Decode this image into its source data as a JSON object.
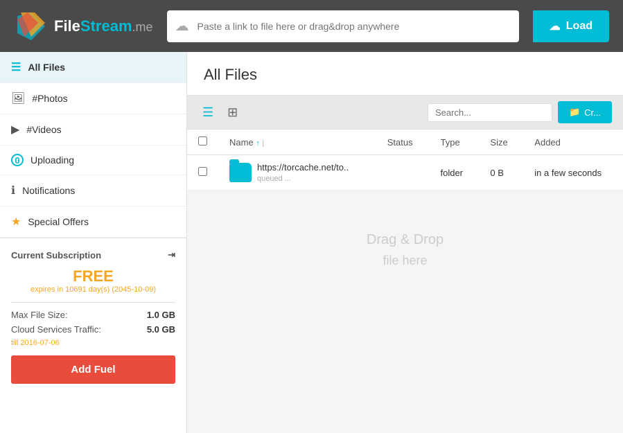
{
  "header": {
    "logo_file": "File",
    "logo_stream": "Stream",
    "logo_me": ".me",
    "url_placeholder": "Paste a link to file here or drag&drop anywhere",
    "load_label": "Load",
    "load_icon": "☁"
  },
  "sidebar": {
    "items": [
      {
        "id": "all-files",
        "icon": "☰",
        "label": "All Files",
        "active": true
      },
      {
        "id": "photos",
        "icon": "🖼",
        "label": "#Photos",
        "active": false
      },
      {
        "id": "videos",
        "icon": "▶",
        "label": "#Videos",
        "active": false
      },
      {
        "id": "uploading",
        "icon": "⓪",
        "label": "Uploading",
        "active": false
      },
      {
        "id": "notifications",
        "icon": "ℹ",
        "label": "Notifications",
        "active": false
      },
      {
        "id": "special-offers",
        "icon": "★",
        "label": "Special Offers",
        "active": false
      }
    ],
    "subscription": {
      "title": "Current Subscription",
      "plan": "FREE",
      "expires": "expires in 10691 day(s) (2045-10-09)",
      "max_file_size_label": "Max File Size:",
      "max_file_size_value": "1.0 GB",
      "traffic_label": "Cloud Services Traffic:",
      "traffic_value": "5.0 GB",
      "traffic_note": "till 2016-07-06",
      "add_fuel_label": "Add Fuel"
    }
  },
  "content": {
    "page_title": "All Files",
    "toolbar": {
      "list_view_icon": "☰",
      "grid_view_icon": "⊞",
      "search_placeholder": "Search...",
      "create_label": "Cr..."
    },
    "table": {
      "columns": [
        "",
        "Name",
        "Status",
        "Type",
        "Size",
        "Added"
      ],
      "name_sort_arrow": "↑",
      "rows": [
        {
          "name": "https://torcache.net/to..",
          "status": "queued ...",
          "type": "folder",
          "size": "0 B",
          "added": "in a few seconds"
        }
      ]
    },
    "drag_drop": {
      "line1": "Drag & Drop",
      "line2": "file here"
    }
  }
}
